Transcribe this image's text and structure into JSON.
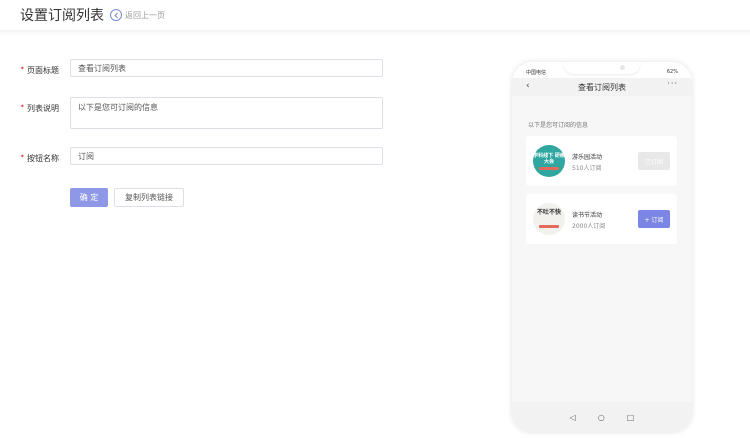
{
  "header": {
    "title": "设置订阅列表",
    "back_label": "返回上一页"
  },
  "form": {
    "page_title": {
      "label": "页面标题",
      "value": "查看订阅列表"
    },
    "list_desc": {
      "label": "列表说明",
      "value": "以下是您可订阅的信息"
    },
    "button_name": {
      "label": "按钮名称",
      "value": "订阅"
    },
    "ok_label": "确 定",
    "copy_label": "复制列表链接"
  },
  "phone": {
    "status_left": "中国电信",
    "status_right": "62%",
    "nav_title": "查看订阅列表",
    "nav_more": "···",
    "nav_back": "‹",
    "desc": "以下是您可订阅的信息",
    "cards": [
      {
        "thumb_text": "学科线下 研练大会",
        "name": "游乐园活动",
        "count": "510人订阅",
        "button": "已订阅"
      },
      {
        "thumb_text": "不吐不快",
        "name": "读书节活动",
        "count": "2000人订阅",
        "button": "+ 订阅"
      }
    ],
    "nav_keys": [
      "◁",
      "○",
      "□"
    ]
  }
}
